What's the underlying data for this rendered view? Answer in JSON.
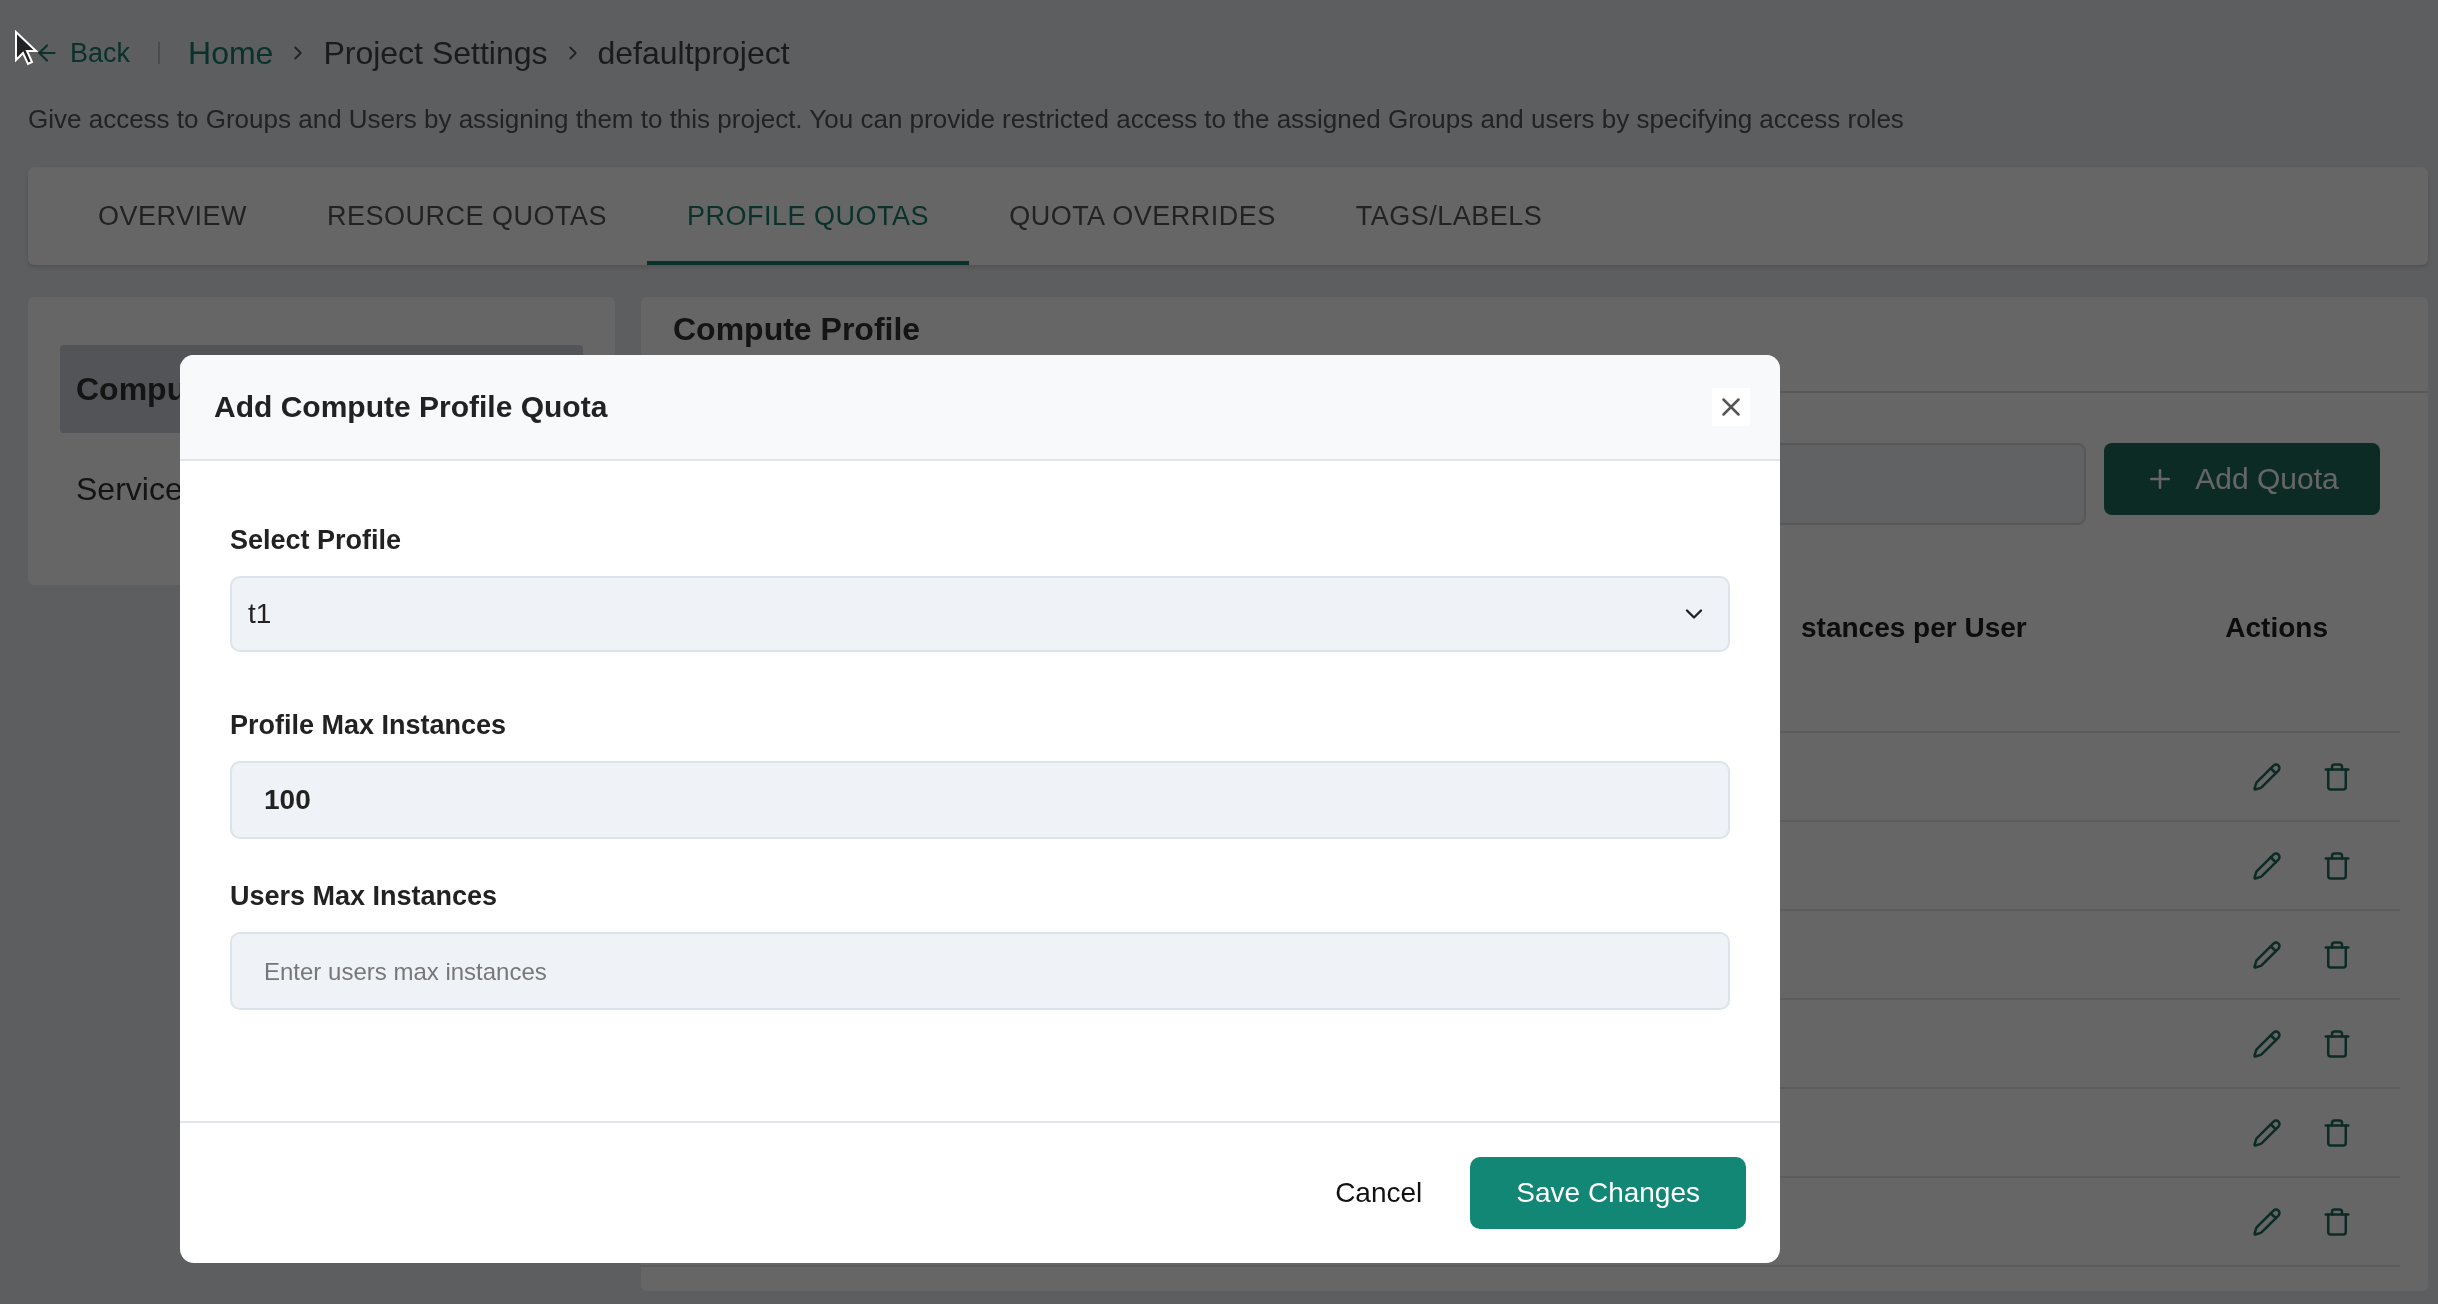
{
  "breadcrumb": {
    "back": "Back",
    "items": [
      {
        "label": "Home",
        "link": true
      },
      {
        "label": "Project Settings",
        "link": false
      },
      {
        "label": "defaultproject",
        "link": false
      }
    ]
  },
  "description": "Give access to Groups and Users by assigning them to this project. You can provide restricted access to the assigned Groups and users by specifying access roles",
  "tabs": [
    {
      "label": "OVERVIEW",
      "selected": false
    },
    {
      "label": "RESOURCE QUOTAS",
      "selected": false
    },
    {
      "label": "PROFILE QUOTAS",
      "selected": true
    },
    {
      "label": "QUOTA OVERRIDES",
      "selected": false
    },
    {
      "label": "TAGS/LABELS",
      "selected": false
    }
  ],
  "sidebar": {
    "items": [
      {
        "label": "Compu",
        "selected": true
      },
      {
        "label": "Service",
        "selected": false
      }
    ]
  },
  "panel": {
    "title": "Compute Profile",
    "add_button": "Add Quota",
    "table": {
      "columns": [
        "stances per User",
        "Actions"
      ],
      "rows": [
        {
          "actions": true
        },
        {
          "actions": true
        },
        {
          "actions": true
        },
        {
          "actions": true
        },
        {
          "actions": true
        },
        {
          "actions": true
        }
      ]
    }
  },
  "dialog": {
    "title": "Add Compute Profile Quota",
    "fields": [
      {
        "kind": "select",
        "label": "Select Profile",
        "value": "t1"
      },
      {
        "kind": "input",
        "label": "Profile Max Instances",
        "value": "100"
      },
      {
        "kind": "input",
        "label": "Users Max Instances",
        "placeholder": "Enter users max instances"
      }
    ],
    "buttons": {
      "cancel": "Cancel",
      "save": "Save Changes"
    }
  }
}
